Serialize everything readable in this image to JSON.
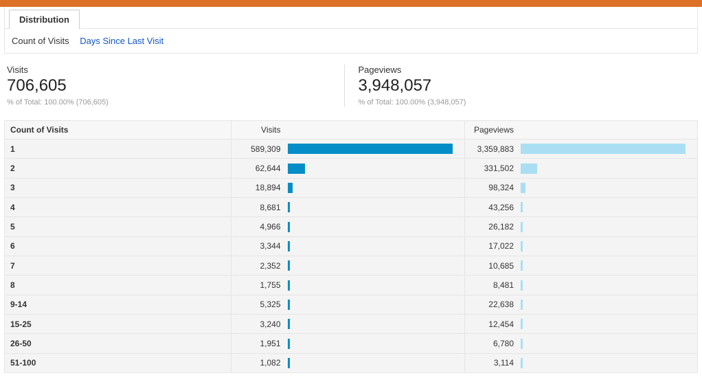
{
  "tabs": {
    "distribution": "Distribution"
  },
  "subtabs": {
    "count": "Count of Visits",
    "days": "Days Since Last Visit"
  },
  "summary": {
    "visits": {
      "label": "Visits",
      "value": "706,605",
      "sub": "% of Total: 100.00% (706,605)"
    },
    "pageviews": {
      "label": "Pageviews",
      "value": "3,948,057",
      "sub": "% of Total: 100.00% (3,948,057)"
    }
  },
  "table": {
    "headers": {
      "count": "Count of Visits",
      "visits": "Visits",
      "pageviews": "Pageviews"
    },
    "maxVisits": 589309,
    "maxPageviews": 3359883,
    "rows": [
      {
        "bucket": "1",
        "visits": 589309,
        "visits_s": "589,309",
        "pv": 3359883,
        "pv_s": "3,359,883"
      },
      {
        "bucket": "2",
        "visits": 62644,
        "visits_s": "62,644",
        "pv": 331502,
        "pv_s": "331,502"
      },
      {
        "bucket": "3",
        "visits": 18894,
        "visits_s": "18,894",
        "pv": 98324,
        "pv_s": "98,324"
      },
      {
        "bucket": "4",
        "visits": 8681,
        "visits_s": "8,681",
        "pv": 43256,
        "pv_s": "43,256"
      },
      {
        "bucket": "5",
        "visits": 4966,
        "visits_s": "4,966",
        "pv": 26182,
        "pv_s": "26,182"
      },
      {
        "bucket": "6",
        "visits": 3344,
        "visits_s": "3,344",
        "pv": 17022,
        "pv_s": "17,022"
      },
      {
        "bucket": "7",
        "visits": 2352,
        "visits_s": "2,352",
        "pv": 10685,
        "pv_s": "10,685"
      },
      {
        "bucket": "8",
        "visits": 1755,
        "visits_s": "1,755",
        "pv": 8481,
        "pv_s": "8,481"
      },
      {
        "bucket": "9-14",
        "visits": 5325,
        "visits_s": "5,325",
        "pv": 22638,
        "pv_s": "22,638"
      },
      {
        "bucket": "15-25",
        "visits": 3240,
        "visits_s": "3,240",
        "pv": 12454,
        "pv_s": "12,454"
      },
      {
        "bucket": "26-50",
        "visits": 1951,
        "visits_s": "1,951",
        "pv": 6780,
        "pv_s": "6,780"
      },
      {
        "bucket": "51-100",
        "visits": 1082,
        "visits_s": "1,082",
        "pv": 3114,
        "pv_s": "3,114"
      }
    ]
  },
  "chart_data": {
    "type": "bar",
    "title": "",
    "xlabel": "",
    "ylabel": "",
    "categories": [
      "1",
      "2",
      "3",
      "4",
      "5",
      "6",
      "7",
      "8",
      "9-14",
      "15-25",
      "26-50",
      "51-100"
    ],
    "series": [
      {
        "name": "Visits",
        "values": [
          589309,
          62644,
          18894,
          8681,
          4966,
          3344,
          2352,
          1755,
          5325,
          3240,
          1951,
          1082
        ]
      },
      {
        "name": "Pageviews",
        "values": [
          3359883,
          331502,
          98324,
          43256,
          26182,
          17022,
          10685,
          8481,
          22638,
          12454,
          6780,
          3114
        ]
      }
    ]
  }
}
